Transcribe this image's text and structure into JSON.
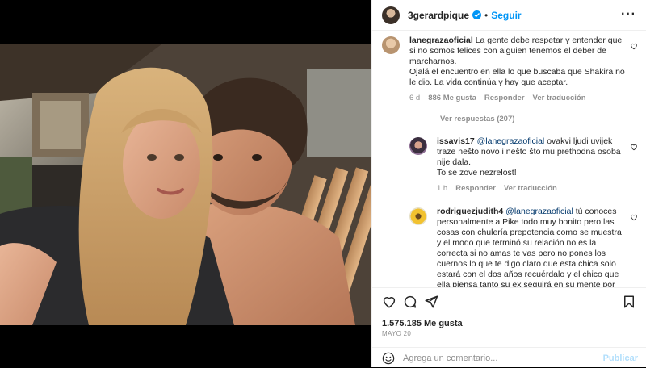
{
  "header": {
    "username": "3gerardpique",
    "separator": "•",
    "follow_label": "Seguir",
    "more_label": "···"
  },
  "comments": [
    {
      "username": "lanegrazaoficial",
      "text": "La gente debe respetar y entender que si no somos felices con alguien tenemos el deber de marcharnos.",
      "text2": "Ojalá el encuentro en ella lo que buscaba que Shakira no le dio. La vida continúa y hay que aceptar.",
      "time": "6 d",
      "likes": "886 Me gusta",
      "reply_label": "Responder",
      "translate_label": "Ver traducción"
    }
  ],
  "replies_toggle": "Ver respuestas (207)",
  "replies": [
    {
      "username": "issavis17",
      "mention": "@lanegrazaoficial",
      "text": "ovakvi ljudi uvijek traze nešto novo i nešto što mu prethodna osoba nije dala.",
      "text2": "To se zove nezrelost!",
      "time": "1 h",
      "reply_label": "Responder",
      "translate_label": "Ver traducción"
    },
    {
      "username": "rodriguezjudith4",
      "mention": "@lanegrazaoficial",
      "text": "tú conoces personalmente a Pike todo muy bonito pero las cosas con chulería prepotencia como se muestra y el modo que terminó su relación no es la correcta si no amas te vas pero no pones los cuernos lo que te digo claro que esta chica solo estará con el dos años recuérdalo y el chico que ella piensa tanto su ex seguirá en su mente por muchísimo tiempo guapo y joven como ella lo de Pike solo una ilusión Shakira le dará igual completamente todo porque su"
    }
  ],
  "post": {
    "likes": "1.575.185 Me gusta",
    "date": "MAYO 20"
  },
  "composer": {
    "placeholder": "Agrega un comentario...",
    "publish_label": "Publicar"
  },
  "icons": {
    "like": "heart-icon",
    "comment": "comment-icon",
    "share": "share-icon",
    "save": "bookmark-icon",
    "emoji": "emoji-icon",
    "verified": "verified-badge-icon"
  },
  "colors": {
    "link_blue": "#0095f6",
    "mention_blue": "#00376b",
    "muted": "#8e8e8e",
    "publish_disabled": "#b2dffc"
  }
}
